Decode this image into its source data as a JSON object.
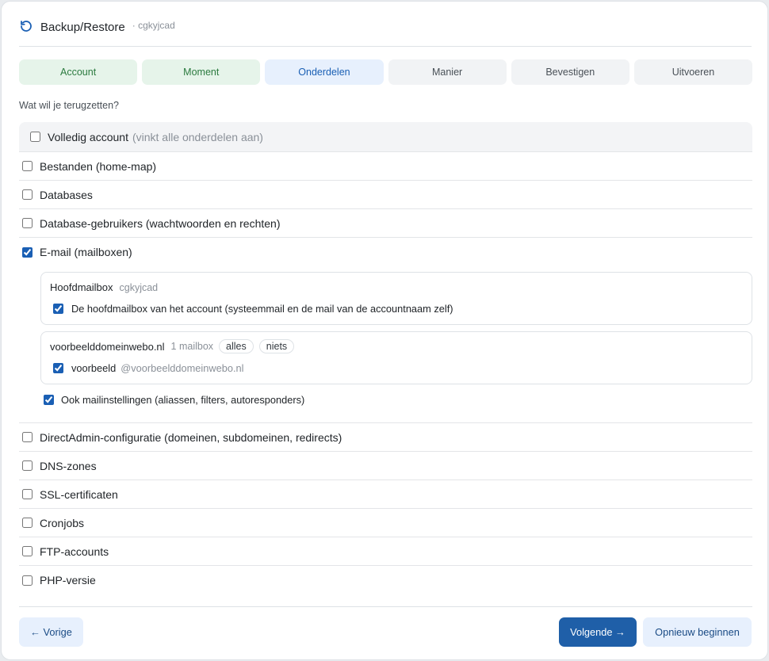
{
  "header": {
    "icon": "refresh-icon",
    "title": "Backup/Restore",
    "account": "· cgkyjcad"
  },
  "steps": [
    {
      "label": "Account",
      "state": "done"
    },
    {
      "label": "Moment",
      "state": "done"
    },
    {
      "label": "Onderdelen",
      "state": "active"
    },
    {
      "label": "Manier",
      "state": "pending"
    },
    {
      "label": "Bevestigen",
      "state": "pending"
    },
    {
      "label": "Uitvoeren",
      "state": "pending"
    }
  ],
  "question": "Wat wil je terugzetten?",
  "full_account": {
    "label": "Volledig account",
    "hint": "(vinkt alle onderdelen aan)",
    "checked": false
  },
  "items": {
    "files": {
      "label": "Bestanden (home-map)",
      "checked": false
    },
    "databases": {
      "label": "Databases",
      "checked": false
    },
    "db_users": {
      "label": "Database-gebruikers (wachtwoorden en rechten)",
      "checked": false
    },
    "email": {
      "label": "E-mail (mailboxen)",
      "checked": true
    },
    "directadmin": {
      "label": "DirectAdmin-configuratie (domeinen, subdomeinen, redirects)",
      "checked": false
    },
    "dns": {
      "label": "DNS-zones",
      "checked": false
    },
    "ssl": {
      "label": "SSL-certificaten",
      "checked": false
    },
    "cron": {
      "label": "Cronjobs",
      "checked": false
    },
    "ftp": {
      "label": "FTP-accounts",
      "checked": false
    },
    "php": {
      "label": "PHP-versie",
      "checked": false
    }
  },
  "email": {
    "main_mailbox": {
      "title": "Hoofdmailbox",
      "account": "cgkyjcad",
      "item_label": "De hoofdmailbox van het account (systeemmail en de mail van de accountnaam zelf)",
      "checked": true
    },
    "domain": {
      "name": "voorbeelddomeinwebo.nl",
      "count": "1 mailbox",
      "all_label": "alles",
      "none_label": "niets",
      "mailbox": {
        "name": "voorbeeld",
        "address": "@voorbeelddomeinwebo.nl",
        "checked": true
      }
    },
    "settings": {
      "label": "Ook mailinstellingen (aliassen, filters, autoresponders)",
      "checked": true
    }
  },
  "footer": {
    "back_label": "← Vorige",
    "next_label": "Volgende →",
    "restart_label": "Opnieuw beginnen"
  },
  "colors": {
    "accent": "#1f5fa8",
    "done_bg": "#e6f4ea",
    "active_bg": "#e7f0fd"
  }
}
